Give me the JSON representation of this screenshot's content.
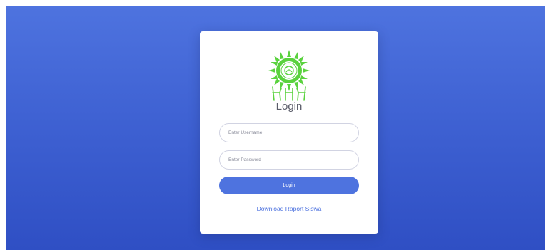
{
  "login_card": {
    "title": "Login",
    "username_placeholder": "Enter Username",
    "password_placeholder": "Enter Password",
    "login_button_label": "Login",
    "download_link_label": "Download Raport Siswa"
  },
  "colors": {
    "background_gradient_top": "#4e73df",
    "background_gradient_bottom": "#2f4fc4",
    "accent": "#4e73df",
    "logo_green": "#5ad23e"
  },
  "icons": {
    "logo": "school-emblem-logo"
  }
}
